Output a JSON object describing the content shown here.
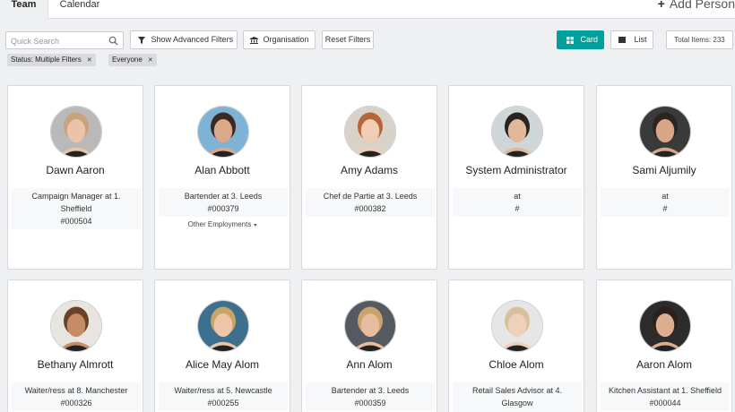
{
  "tabs": [
    {
      "label": "Team",
      "active": true
    },
    {
      "label": "Calendar",
      "active": false
    }
  ],
  "add_person_label": "Add Person",
  "search": {
    "placeholder": "Quick Search",
    "value": ""
  },
  "toolbar": {
    "advanced_filters_label": "Show Advanced Filters",
    "organisation_label": "Organisation",
    "reset_filters_label": "Reset Filters",
    "card_view_label": "Card",
    "list_view_label": "List",
    "total_items_label": "Total Items: 233"
  },
  "active_filters": [
    {
      "label": "Status: Multiple Filters"
    },
    {
      "label": "Everyone"
    }
  ],
  "colors": {
    "accent": "#00a09d",
    "card_border": "#d6d9dd",
    "background": "#eef0f2"
  },
  "people": [
    {
      "name": "Dawn Aaron",
      "job_line1": "Campaign Manager at 1.",
      "job_line2": "Sheffield",
      "id": "#000504",
      "extra": "",
      "skin": "#e9c4a8",
      "hair": "#c9a27a",
      "bg": "#b9b9b9"
    },
    {
      "name": "Alan Abbott",
      "job_line1": "Bartender at 3. Leeds",
      "job_line2": "",
      "id": "#000379",
      "extra": "Other Employments",
      "skin": "#d9a98a",
      "hair": "#3a2a20",
      "bg": "#7fb3d5"
    },
    {
      "name": "Amy Adams",
      "job_line1": "Chef de Partie at 3. Leeds",
      "job_line2": "",
      "id": "#000382",
      "extra": "",
      "skin": "#f0cdb4",
      "hair": "#b5653a",
      "bg": "#d8d2c8"
    },
    {
      "name": "System Administrator",
      "job_line1": "at",
      "job_line2": "",
      "id": "#",
      "extra": "",
      "skin": "#e2b89a",
      "hair": "#2a2420",
      "bg": "#cfd6d8"
    },
    {
      "name": "Sami Aljumily",
      "job_line1": "at",
      "job_line2": "",
      "id": "#",
      "extra": "",
      "skin": "#d7a688",
      "hair": "#2b241f",
      "bg": "#3a3a3a"
    },
    {
      "name": "Bethany Almrott",
      "job_line1": "Waiter/ress at 8. Manchester",
      "job_line2": "",
      "id": "#000326",
      "extra": "",
      "skin": "#c58c66",
      "hair": "#6a4228",
      "bg": "#e8e4df"
    },
    {
      "name": "Alice May Alom",
      "job_line1": "Waiter/ress at 5. Newcastle",
      "job_line2": "",
      "id": "#000255",
      "extra": "",
      "skin": "#edc6a9",
      "hair": "#c9a467",
      "bg": "#3d6f8f"
    },
    {
      "name": "Ann Alom",
      "job_line1": "Bartender at 3. Leeds",
      "job_line2": "",
      "id": "#000359",
      "extra": "",
      "skin": "#e6bd9e",
      "hair": "#c9a36b",
      "bg": "#555a60"
    },
    {
      "name": "Chloe Alom",
      "job_line1": "Retail Sales Advisor at 4.",
      "job_line2": "Glasgow",
      "id": "#000170",
      "extra": "",
      "skin": "#efd0ba",
      "hair": "#d9c09a",
      "bg": "#e6e6e6"
    },
    {
      "name": "Aaron Alom",
      "job_line1": "Kitchen Assistant at 1. Sheffield",
      "job_line2": "",
      "id": "#000044",
      "extra": "",
      "skin": "#dcae90",
      "hair": "#2a211c",
      "bg": "#2c2c2c"
    }
  ]
}
